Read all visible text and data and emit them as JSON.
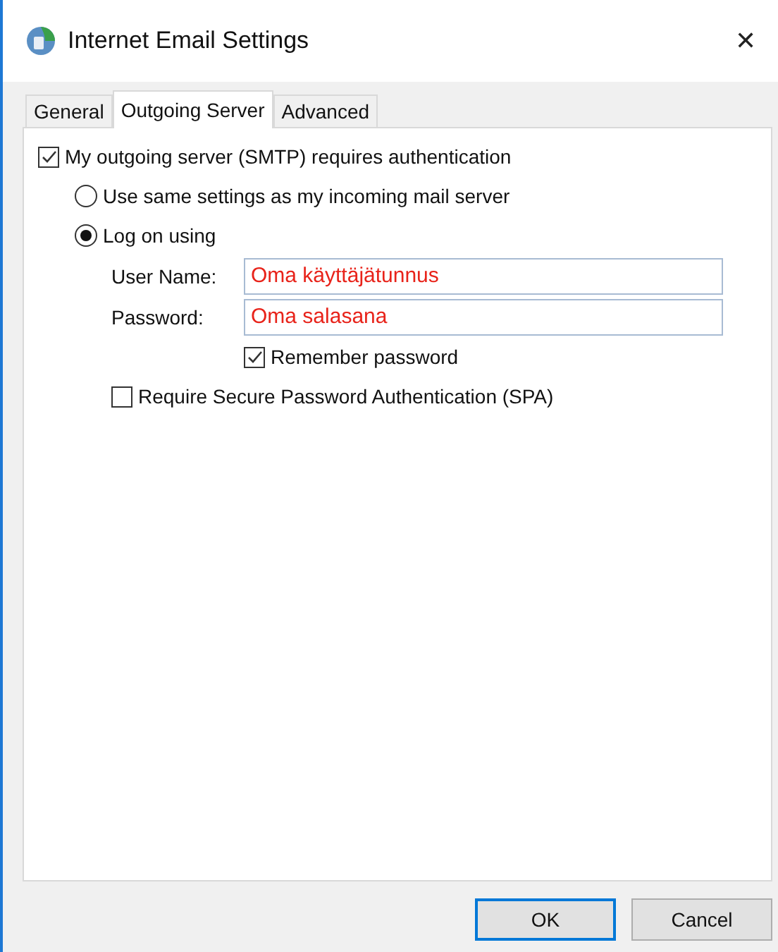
{
  "window": {
    "title": "Internet Email Settings",
    "close": "✕"
  },
  "tabs": [
    {
      "label": "General",
      "selected": false
    },
    {
      "label": "Outgoing Server",
      "selected": true
    },
    {
      "label": "Advanced",
      "selected": false
    }
  ],
  "auth": {
    "label": "My outgoing server (SMTP) requires authentication",
    "checked": true
  },
  "auth_options": [
    {
      "label": "Use same settings as my incoming mail server",
      "selected": false
    },
    {
      "label": "Log on using",
      "selected": true
    }
  ],
  "fields": [
    {
      "label": "User Name:",
      "value": "Oma käyttäjätunnus"
    },
    {
      "label": "Password:",
      "value": "Oma salasana"
    }
  ],
  "remember": {
    "label": "Remember password",
    "checked": true
  },
  "spa": {
    "label": "Require Secure Password Authentication (SPA)",
    "checked": false
  },
  "buttons": [
    {
      "label": "OK",
      "default": true
    },
    {
      "label": "Cancel",
      "default": false
    }
  ]
}
